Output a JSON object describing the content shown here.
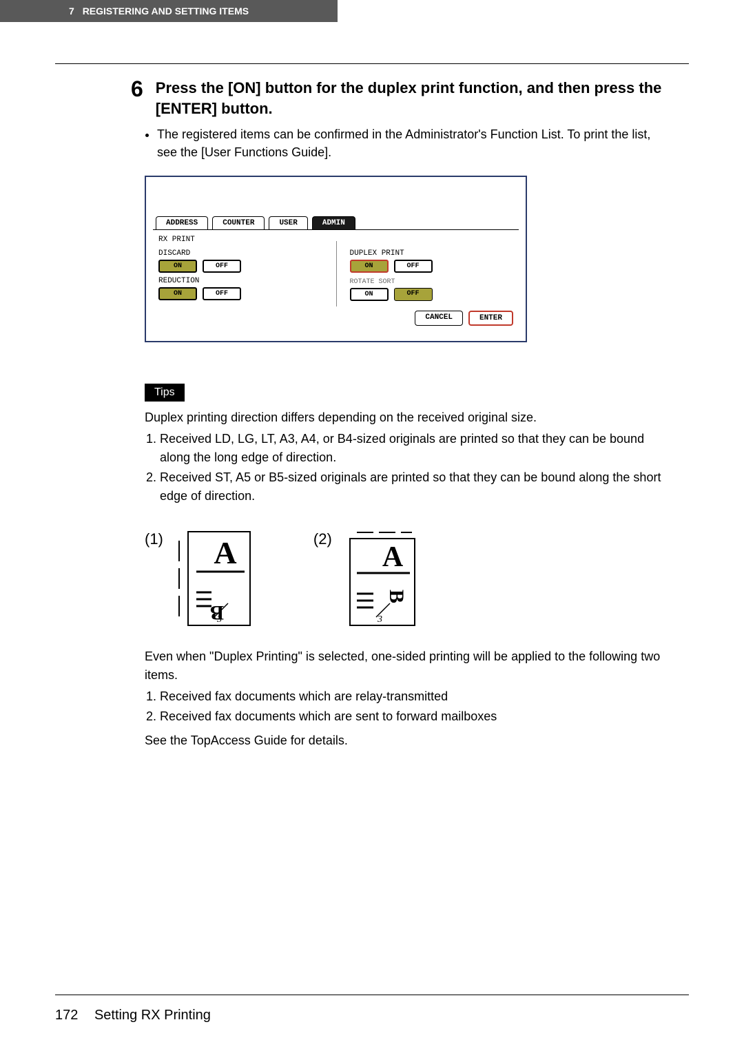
{
  "header": {
    "chapter_num": "7",
    "chapter_title": "REGISTERING AND SETTING ITEMS"
  },
  "step": {
    "number": "6",
    "title": "Press the [ON] button for the duplex print function, and then press the [ENTER] button.",
    "bullet": "The registered items can be confirmed in the Administrator's Function List. To print the list, see the [User Functions Guide]."
  },
  "panel": {
    "tabs": {
      "address": "ADDRESS",
      "counter": "COUNTER",
      "user": "USER",
      "admin": "ADMIN"
    },
    "section_label": "RX PRINT",
    "left": {
      "discard_label": "DISCARD",
      "discard_on": "ON",
      "discard_off": "OFF",
      "reduction_label": "REDUCTION",
      "reduction_on": "ON",
      "reduction_off": "OFF"
    },
    "right": {
      "duplex_label": "DUPLEX PRINT",
      "duplex_on": "ON",
      "duplex_off": "OFF",
      "rotate_label": "ROTATE SORT",
      "rotate_on": "ON",
      "rotate_off": "OFF"
    },
    "actions": {
      "cancel": "CANCEL",
      "enter": "ENTER"
    }
  },
  "tips": {
    "label": "Tips",
    "intro": "Duplex printing direction differs depending on the received original size.",
    "items": [
      "Received LD, LG, LT, A3, A4, or B4-sized originals are printed so that they can be bound along the long edge of direction.",
      "Received ST, A5 or B5-sized originals are printed so that they can be bound along the short edge of direction."
    ],
    "diagrams": {
      "n1": "(1)",
      "n2": "(2)"
    },
    "para2": "Even when \"Duplex Printing\" is selected, one-sided printing will be applied to the following two items.",
    "items2": [
      "Received fax documents which are relay-transmitted",
      "Received fax documents which are sent to forward mailboxes"
    ],
    "para3": "See the TopAccess Guide for details."
  },
  "footer": {
    "page": "172",
    "section": "Setting RX Printing"
  }
}
